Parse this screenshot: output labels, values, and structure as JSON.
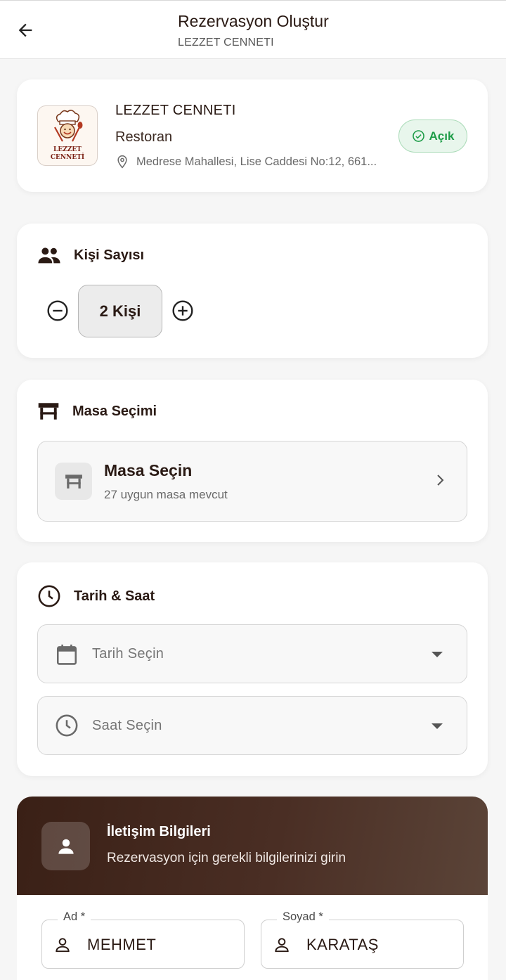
{
  "header": {
    "title": "Rezervasyon Oluştur",
    "subtitle": "LEZZET CENNETI"
  },
  "restaurant": {
    "logo_text": "LEZZET CENNETİ",
    "name": "LEZZET CENNETI",
    "type": "Restoran",
    "address": "Medrese Mahallesi, Lise Caddesi No:12, 661...",
    "status": "Açık"
  },
  "guests": {
    "title": "Kişi Sayısı",
    "count_label": "2 Kişi"
  },
  "table": {
    "title": "Masa Seçimi",
    "select_label": "Masa Seçin",
    "available": "27 uygun masa mevcut"
  },
  "datetime": {
    "title": "Tarih & Saat",
    "date_placeholder": "Tarih Seçin",
    "time_placeholder": "Saat Seçin"
  },
  "contact": {
    "title": "İletişim Bilgileri",
    "subtitle": "Rezervasyon için gerekli bilgilerinizi girin",
    "first_name_label": "Ad *",
    "first_name": "MEHMET",
    "last_name_label": "Soyad *",
    "last_name": "KARATAŞ"
  },
  "colors": {
    "brand_dark": "#3a2016",
    "open_green": "#1e9d48",
    "background": "#f6f6f6"
  }
}
